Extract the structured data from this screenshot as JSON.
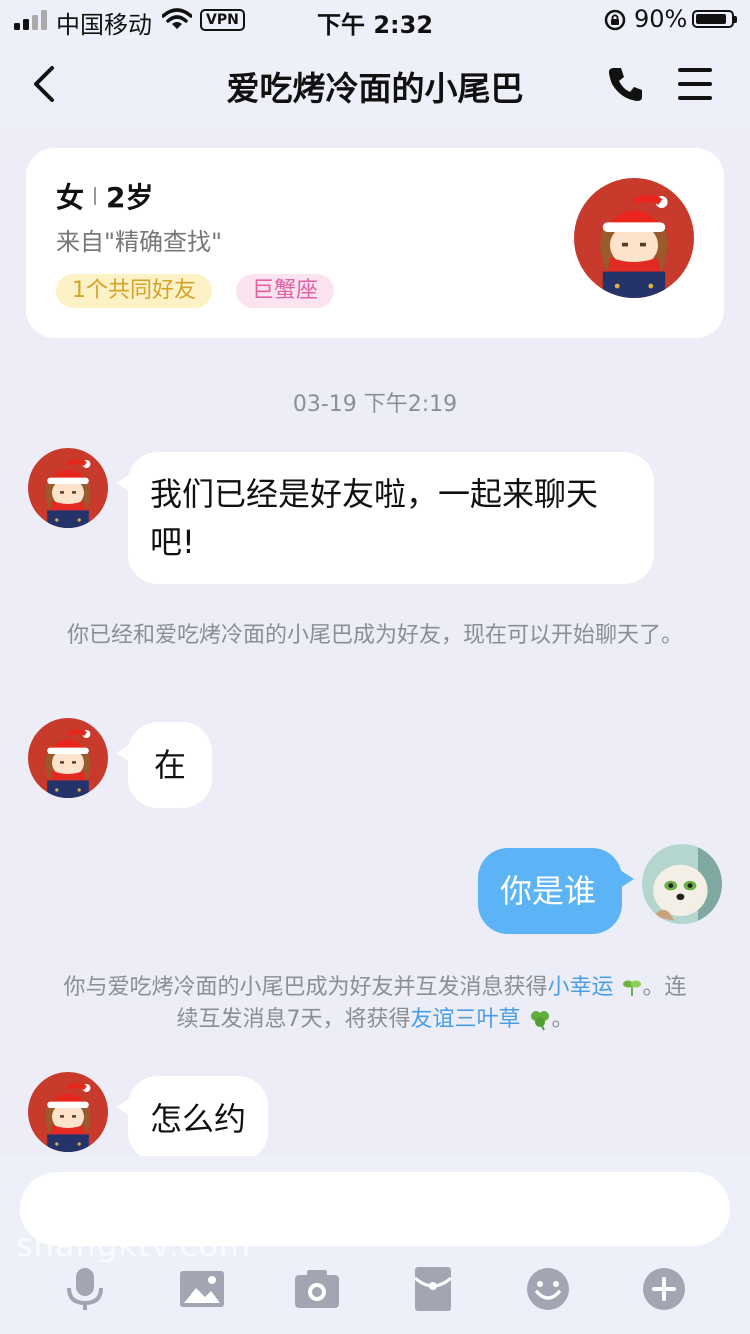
{
  "status_bar": {
    "carrier": "中国移动",
    "vpn": "VPN",
    "time": "下午 2:32",
    "battery_text": "90%",
    "battery_level": 0.9
  },
  "nav": {
    "title": "爱吃烤冷面的小尾巴"
  },
  "profile": {
    "gender": "女",
    "age": "2岁",
    "source": "来自\"精确查找\"",
    "tags": [
      "1个共同好友",
      "巨蟹座"
    ]
  },
  "chat": {
    "timestamp": "03-19 下午2:19",
    "messages": [
      {
        "text": "我们已经是好友啦，一起来聊天吧!",
        "direction": "in"
      },
      {
        "text": "在",
        "direction": "in"
      },
      {
        "text": "你是谁",
        "direction": "out"
      },
      {
        "text": "怎么约",
        "direction": "in"
      }
    ],
    "system_notes": {
      "friend_notice": "你已经和爱吃烤冷面的小尾巴成为好友，现在可以开始聊天了。",
      "lucky_prefix": "你与爱吃烤冷面的小尾巴成为好友并互发消息获得",
      "lucky_link": "小幸运",
      "lucky_middle": "。连续互发消息7天，将获得",
      "clover_link": "友谊三叶草",
      "lucky_end": "。"
    }
  },
  "input": {
    "watermark": "shangktv.com"
  },
  "toolbar": [
    "mic-icon",
    "image-icon",
    "camera-icon",
    "red-packet-icon",
    "emoji-icon",
    "plus-icon"
  ],
  "colors": {
    "background": "#ecedf6",
    "outgoing_bubble": "#5cb4f6",
    "link": "#4a9ee8",
    "tag_friends_bg": "#fdf1c6",
    "tag_zodiac_bg": "#fbe3ef"
  }
}
